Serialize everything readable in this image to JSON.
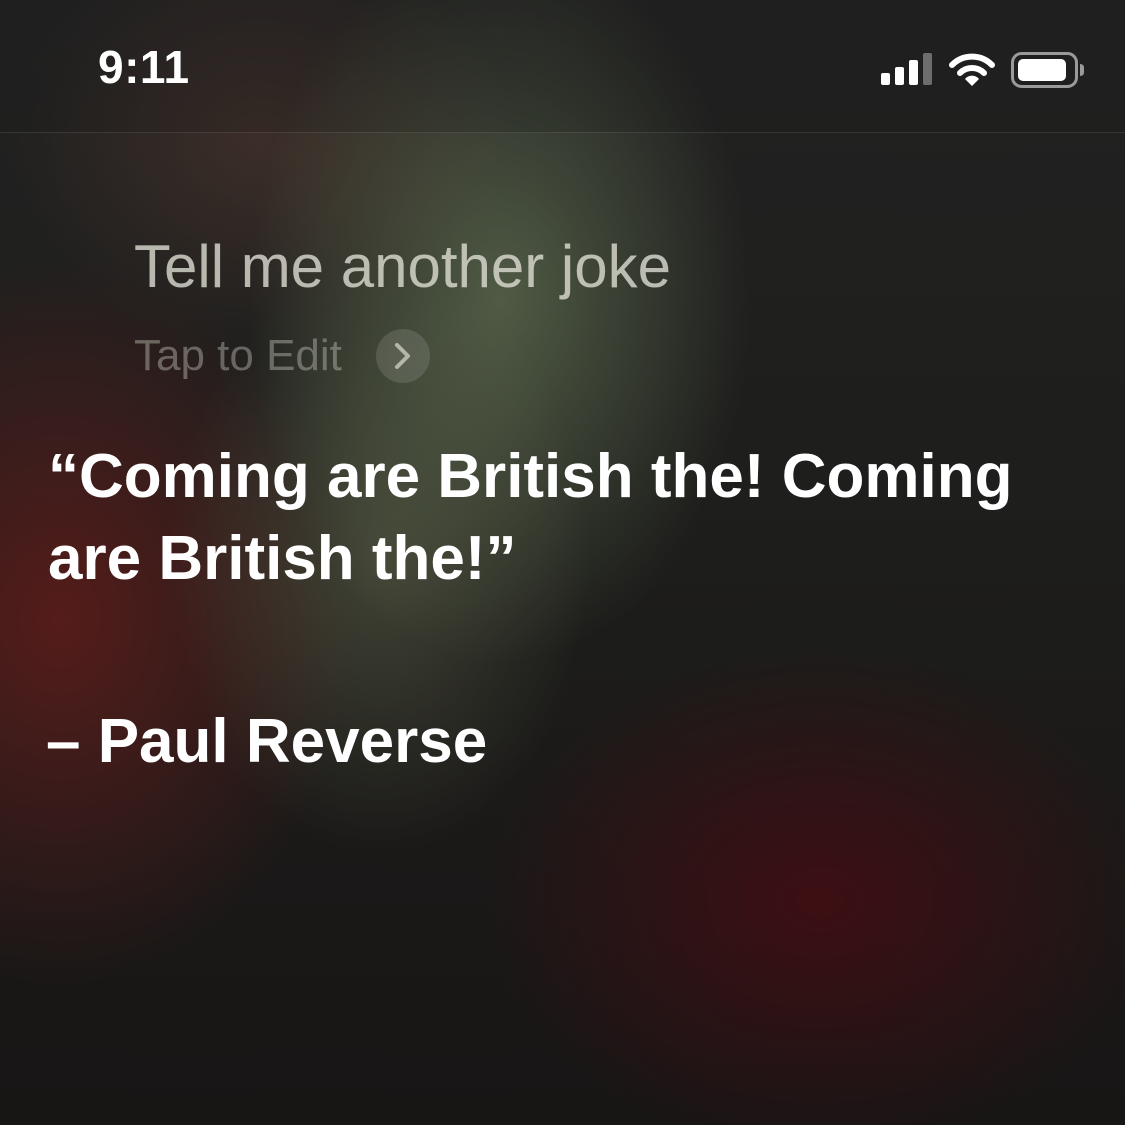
{
  "status_bar": {
    "time": "9:11",
    "icons": [
      "cellular-signal-icon",
      "wifi-icon",
      "battery-icon"
    ]
  },
  "siri": {
    "query": "Tell me another joke",
    "edit_hint": "Tap to Edit",
    "edit_chevron_icon": "chevron-right-icon",
    "response": "“Coming are British the! Coming are British the!”",
    "attribution": "– Paul Reverse"
  },
  "colors": {
    "text_primary": "#ffffff",
    "background_green_glow": "#788c64",
    "background_red_glow": "#5f1c1a"
  }
}
